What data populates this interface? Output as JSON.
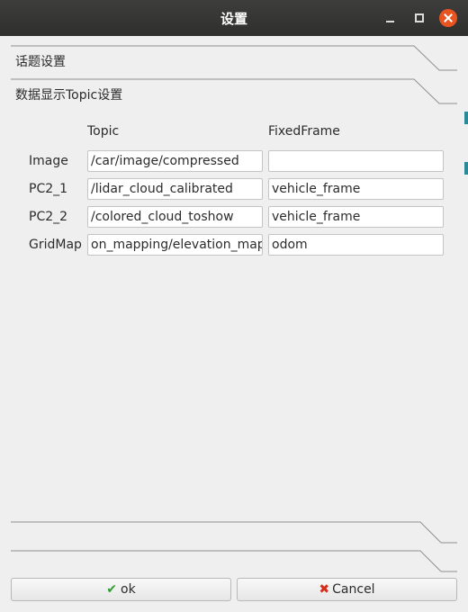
{
  "window": {
    "title": "设置"
  },
  "sections": {
    "topic_settings": "话题设置",
    "display_topic_settings": "数据显示Topic设置"
  },
  "table": {
    "headers": {
      "topic": "Topic",
      "fixed_frame": "FixedFrame"
    },
    "rows": [
      {
        "label": "Image",
        "topic": "/car/image/compressed",
        "fixed_frame": ""
      },
      {
        "label": "PC2_1",
        "topic": "/lidar_cloud_calibrated",
        "fixed_frame": "vehicle_frame"
      },
      {
        "label": "PC2_2",
        "topic": "/colored_cloud_toshow",
        "fixed_frame": "vehicle_frame"
      },
      {
        "label": "GridMap",
        "topic": "on_mapping/elevation_map",
        "fixed_frame": "odom"
      }
    ]
  },
  "buttons": {
    "ok": "ok",
    "cancel": "Cancel"
  },
  "icons": {
    "ok": "check-icon",
    "cancel": "cross-icon"
  },
  "colors": {
    "titlebar": "#2f2f2d",
    "close": "#e95420",
    "check": "#2e9f2e",
    "cross": "#d62c1a"
  }
}
